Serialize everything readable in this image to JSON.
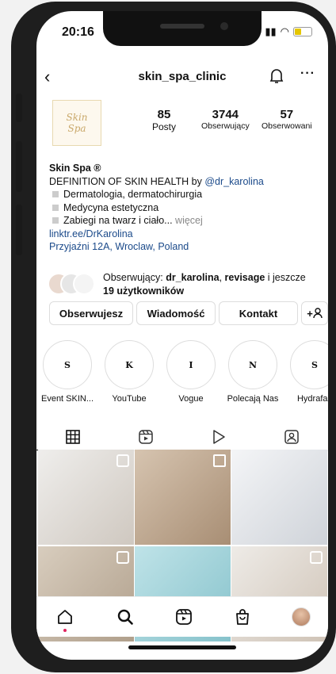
{
  "status": {
    "time": "20:16"
  },
  "header": {
    "username": "skin_spa_clinic"
  },
  "profile": {
    "avatar_lines": [
      "Skin",
      "Spa"
    ],
    "stats": [
      {
        "value": "85",
        "label": "Posty"
      },
      {
        "value": "3744",
        "label": "Obserwujący"
      },
      {
        "value": "57",
        "label": "Obserwowani"
      }
    ]
  },
  "bio": {
    "name": "Skin Spa ®",
    "line1_prefix": "DEFINITION OF SKIN HEALTH by ",
    "line1_mention": "@dr_karolina",
    "bullets": [
      "Dermatologia, dermatochirurgia",
      "Medycyna estetyczna",
      "Zabiegi na twarz i ciało..."
    ],
    "more": " więcej",
    "link": "linktr.ee/DrKarolina",
    "address": "Przyjaźni 12A, Wroclaw, Poland"
  },
  "followed_by": {
    "prefix": "Obserwujący: ",
    "names": "dr_karolina",
    "sep": ", ",
    "names2": "revisage",
    "mid": " i jeszcze ",
    "others": "19 użytkowników"
  },
  "actions": {
    "following": "Obserwujesz",
    "message": "Wiadomość",
    "contact": "Kontakt",
    "add_user_glyph": "+"
  },
  "highlights": [
    {
      "letter": "S",
      "label": "Event SKIN..."
    },
    {
      "letter": "K",
      "label": "YouTube"
    },
    {
      "letter": "I",
      "label": "Vogue"
    },
    {
      "letter": "N",
      "label": "Polecają Nas"
    },
    {
      "letter": "S",
      "label": "Hydrafac"
    }
  ],
  "grid_colors": [
    "#d9d4cf",
    "#c7b39b",
    "#e7e9ee",
    "#bdb3a6",
    "#a9d6dc",
    "#ded7cf"
  ],
  "tabs": [
    "grid-icon",
    "reels-icon",
    "video-icon",
    "tagged-icon"
  ],
  "nav": [
    "home-icon",
    "search-icon",
    "reels-icon",
    "shop-icon",
    "profile-avatar"
  ]
}
